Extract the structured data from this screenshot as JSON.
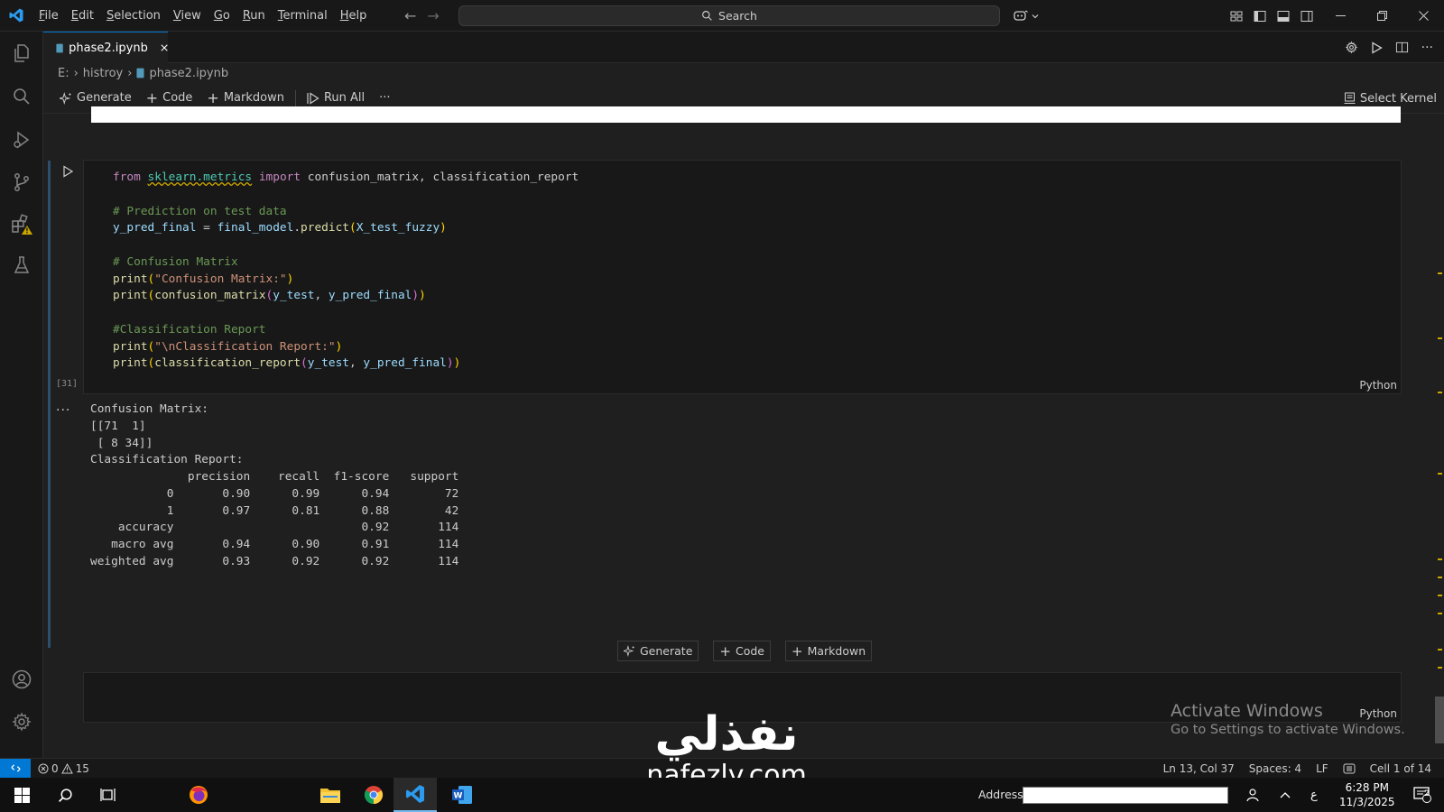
{
  "titlebar": {
    "menu": [
      {
        "label": "File",
        "u": "F",
        "rest": "ile"
      },
      {
        "label": "Edit",
        "u": "E",
        "rest": "dit"
      },
      {
        "label": "Selection",
        "u": "S",
        "rest": "election"
      },
      {
        "label": "View",
        "u": "V",
        "rest": "iew"
      },
      {
        "label": "Go",
        "u": "G",
        "rest": "o"
      },
      {
        "label": "Run",
        "u": "R",
        "rest": "un"
      },
      {
        "label": "Terminal",
        "u": "T",
        "rest": "erminal"
      },
      {
        "label": "Help",
        "u": "H",
        "rest": "elp"
      }
    ],
    "search_label": "Search"
  },
  "tab": {
    "filename": "phase2.ipynb"
  },
  "breadcrumb": {
    "drive": "E:",
    "folder": "histroy",
    "file": "phase2.ipynb"
  },
  "toolbar": {
    "generate": "Generate",
    "code": "Code",
    "markdown": "Markdown",
    "run_all": "Run All",
    "more": "···",
    "select_kernel": "Select Kernel"
  },
  "cell": {
    "exec_count": "[31]",
    "language": "Python",
    "code": {
      "l1_from": "from",
      "l1_mod": "sklearn.metrics",
      "l1_import": "import",
      "l1_rest": " confusion_matrix, classification_report",
      "l3": "# Prediction on test data",
      "l4_var": "y_pred_final",
      "l4_eq": " = ",
      "l4_obj": "final_model",
      "l4_dot": ".",
      "l4_fn": "predict",
      "l4_arg": "X_test_fuzzy",
      "l6": "# Confusion Matrix",
      "l7_fn": "print",
      "l7_str": "\"Confusion Matrix:\"",
      "l8_fn": "print",
      "l8_fn2": "confusion_matrix",
      "l8_a1": "y_test",
      "l8_sep": ", ",
      "l8_a2": "y_pred_final",
      "l10": "#Classification Report",
      "l11_fn": "print",
      "l11_str": "\"\\nClassification Report:\"",
      "l12_fn": "print",
      "l12_fn2": "classification_report",
      "l12_a1": "y_test",
      "l12_sep": ", ",
      "l12_a2": "y_pred_final"
    }
  },
  "output": {
    "more": "···",
    "lines": [
      "Confusion Matrix:",
      "[[71  1]",
      " [ 8 34]]",
      "",
      "Classification Report:",
      "              precision    recall  f1-score   support",
      "",
      "           0       0.90      0.99      0.94        72",
      "           1       0.97      0.81      0.88        42",
      "",
      "    accuracy                           0.92       114",
      "   macro avg       0.94      0.90      0.91       114",
      "weighted avg       0.93      0.92      0.92       114"
    ]
  },
  "insert_bar": {
    "generate": "Generate",
    "code": "Code",
    "markdown": "Markdown"
  },
  "empty_cell": {
    "language": "Python"
  },
  "activate_windows": {
    "title": "Activate Windows",
    "subtitle": "Go to Settings to activate Windows."
  },
  "statusbar": {
    "errors": "0",
    "warnings": "15",
    "position": "Ln 13, Col 37",
    "spaces": "Spaces: 4",
    "eol": "LF",
    "cell": "Cell 1 of 14"
  },
  "taskbar": {
    "address_label": "Address",
    "address_value": "",
    "ime": "ع",
    "time": "6:28 PM",
    "date": "11/3/2025",
    "notif_count": "2"
  },
  "watermark": {
    "arabic": "نفذلي",
    "latin": "nafezly.com"
  },
  "colors": {
    "accent": "#0078d4",
    "warning": "#cca700",
    "bg": "#1f1f1f"
  }
}
